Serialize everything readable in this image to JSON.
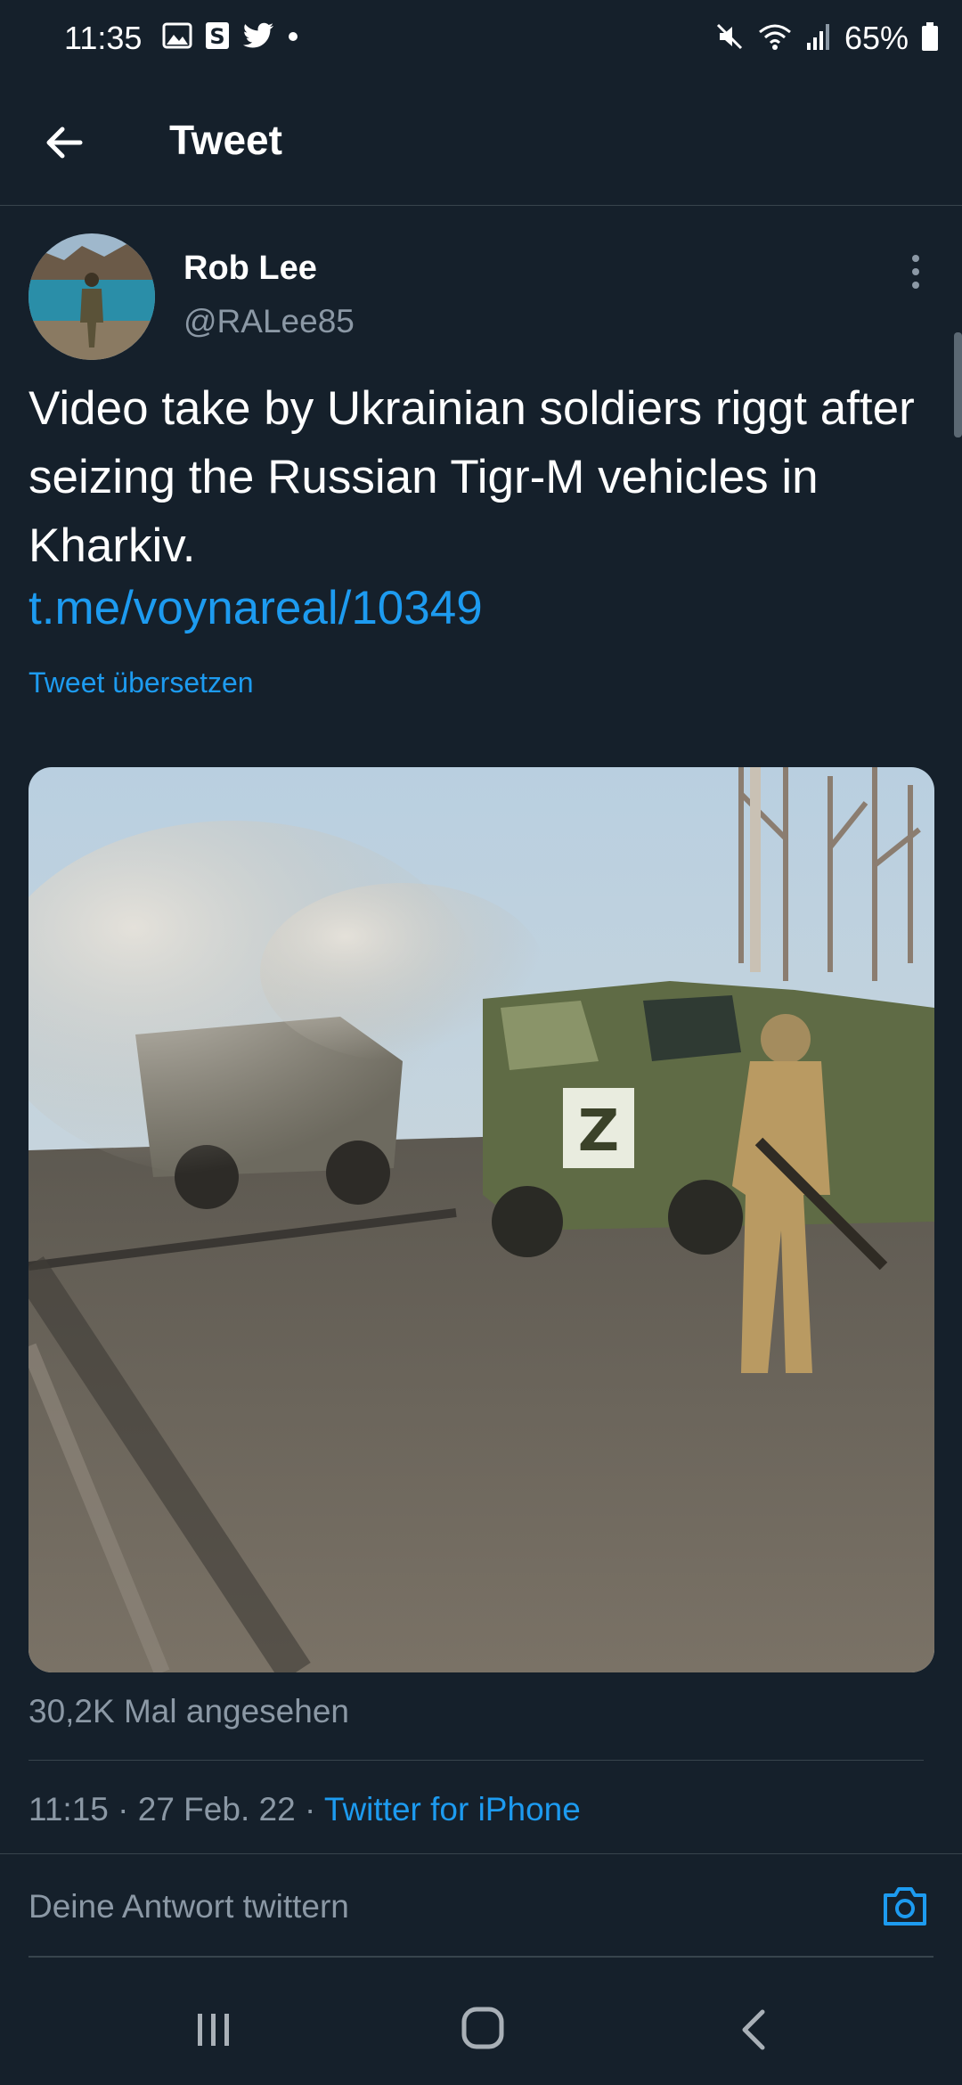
{
  "status_bar": {
    "time": "11:35",
    "battery": "65%",
    "left_icons": [
      "gallery-icon",
      "s-app-icon",
      "twitter-bird-icon",
      "dot-icon"
    ],
    "right_icons": [
      "mute-icon",
      "wifi-icon",
      "signal-icon",
      "battery-icon"
    ]
  },
  "header": {
    "title": "Tweet"
  },
  "tweet": {
    "author_name": "Rob Lee",
    "author_handle": "@RALee85",
    "text": "Video take by Ukrainian soldiers riggt after seizing the Russian Tigr-M vehicles in Kharkiv.",
    "link": "t.me/voynareal/10349",
    "translate_label": "Tweet übersetzen",
    "views": "30,2K Mal angesehen",
    "time": "11:15",
    "separator": "·",
    "date": "27 Feb. 22",
    "source": "Twitter for iPhone"
  },
  "reply": {
    "placeholder": "Deine Antwort twittern"
  },
  "colors": {
    "background": "#15202b",
    "accent": "#1d9bf0",
    "secondary_text": "#8b98a5",
    "divider": "#38444d"
  }
}
